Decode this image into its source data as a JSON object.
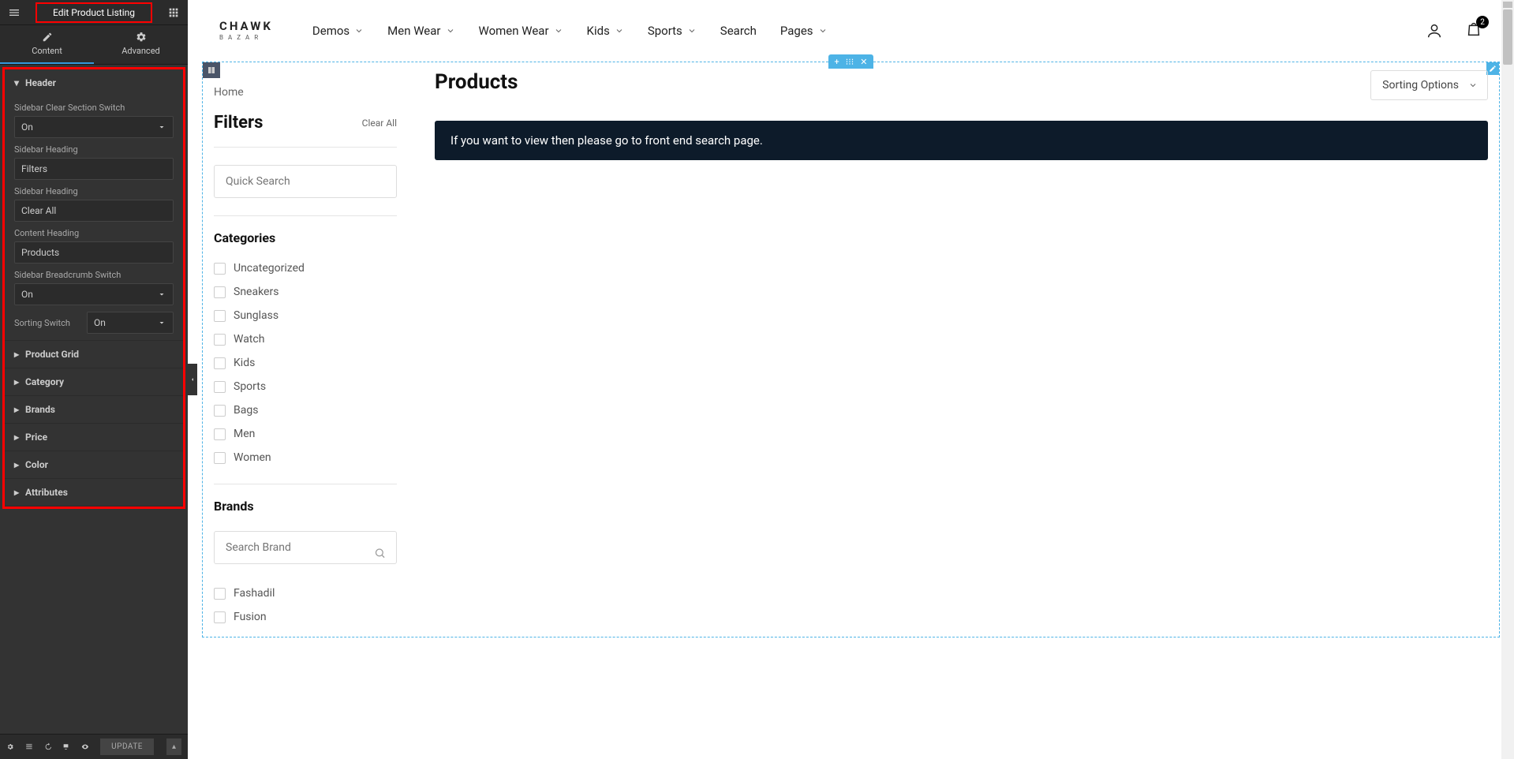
{
  "editor": {
    "title": "Edit Product Listing",
    "tabs": {
      "content": "Content",
      "advanced": "Advanced"
    },
    "sections": {
      "header": "Header",
      "product_grid": "Product Grid",
      "category": "Category",
      "brands": "Brands",
      "price": "Price",
      "color": "Color",
      "attributes": "Attributes"
    },
    "labels": {
      "sidebar_clear_switch": "Sidebar Clear Section Switch",
      "sidebar_heading1": "Sidebar Heading",
      "sidebar_heading2": "Sidebar Heading",
      "content_heading": "Content Heading",
      "sidebar_breadcrumb_switch": "Sidebar Breadcrumb Switch",
      "sorting_switch": "Sorting Switch"
    },
    "values": {
      "clear_switch": "On",
      "heading1": "Filters",
      "heading2": "Clear All",
      "content_heading": "Products",
      "breadcrumb_switch": "On",
      "sorting_switch": "On"
    },
    "update_btn": "UPDATE"
  },
  "site": {
    "logo": "CHAWK",
    "logo_sub": "BAZAR",
    "nav": [
      "Demos",
      "Men Wear",
      "Women Wear",
      "Kids",
      "Sports",
      "Search",
      "Pages"
    ],
    "cart_badge": "2"
  },
  "page": {
    "breadcrumb": "Home",
    "filters_title": "Filters",
    "clear_all": "Clear All",
    "search_placeholder": "Quick Search",
    "categories_title": "Categories",
    "categories": [
      "Uncategorized",
      "Sneakers",
      "Sunglass",
      "Watch",
      "Kids",
      "Sports",
      "Bags",
      "Men",
      "Women"
    ],
    "brands_title": "Brands",
    "brand_placeholder": "Search Brand",
    "brands": [
      "Fashadil",
      "Fusion"
    ],
    "products_title": "Products",
    "sort_label": "Sorting Options",
    "notice": "If you want to view then please go to front end search page."
  }
}
